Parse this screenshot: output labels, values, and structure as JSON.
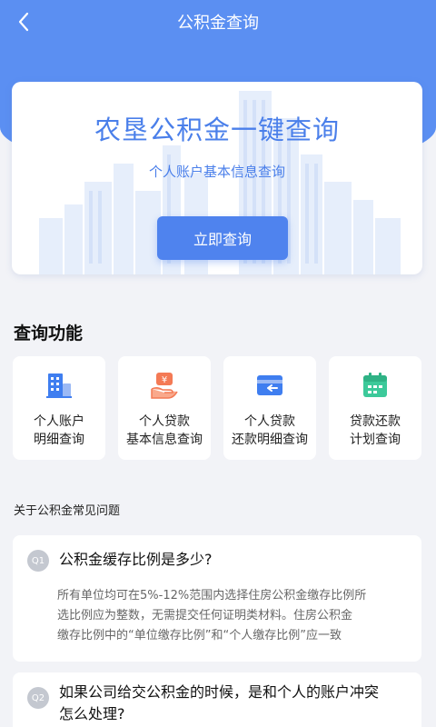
{
  "nav": {
    "title": "公积金查询"
  },
  "hero": {
    "title": "农垦公积金一键查询",
    "subtitle": "个人账户基本信息查询",
    "button_label": "立即查询"
  },
  "functions": {
    "section_title": "查询功能",
    "items": [
      {
        "line1": "个人账户",
        "line2": "明细查询",
        "icon": "building-icon"
      },
      {
        "line1": "个人贷款",
        "line2": "基本信息查询",
        "icon": "loan-hand-icon"
      },
      {
        "line1": "个人贷款",
        "line2": "还款明细查询",
        "icon": "card-return-icon"
      },
      {
        "line1": "贷款还款",
        "line2": "计划查询",
        "icon": "calendar-icon"
      }
    ]
  },
  "faq": {
    "section_title": "关于公积金常见问题",
    "items": [
      {
        "badge": "Q1",
        "question": "公积金缓存比例是多少?",
        "answer_lines": [
          "所有单位均可在5%-12%范围内选择住房公积金缴存比例所",
          "选比例应为整数，无需提交任何证明类材料。住房公积金",
          "缴存比例中的“单位缴存比例”和“个人缴存比例”应一致"
        ]
      },
      {
        "badge": "Q2",
        "question_lines": [
          "如果公司给交公积金的时候，是和个人的账户冲突",
          "怎么处理?"
        ]
      }
    ]
  },
  "colors": {
    "primary": "#4f83ee",
    "header_bg": "#5b8ff2",
    "page_bg": "#f2f3f7"
  }
}
